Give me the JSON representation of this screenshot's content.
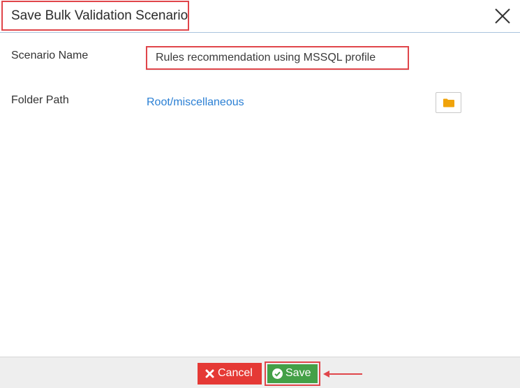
{
  "dialog": {
    "title": "Save Bulk Validation Scenario"
  },
  "form": {
    "scenario_name_label": "Scenario Name",
    "scenario_name_value": "Rules recommendation using MSSQL profile",
    "folder_path_label": "Folder Path",
    "folder_path_value": "Root/miscellaneous"
  },
  "footer": {
    "cancel_label": "Cancel",
    "save_label": "Save"
  },
  "icons": {
    "close": "close-icon",
    "folder": "folder-icon",
    "cancel": "times-icon",
    "save": "check-circle-icon"
  },
  "colors": {
    "highlight": "#e0454a",
    "link": "#2a7fd4",
    "cancel": "#e53935",
    "save": "#43a047",
    "folder": "#f0a30a"
  }
}
